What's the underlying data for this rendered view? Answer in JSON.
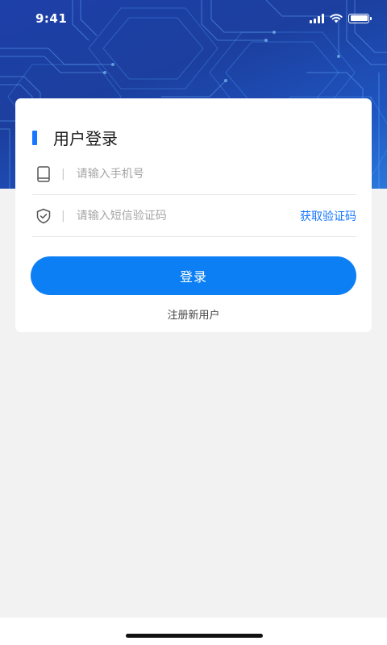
{
  "status_bar": {
    "time": "9:41",
    "icons": [
      "signal-icon",
      "wifi-icon",
      "battery-icon"
    ]
  },
  "login": {
    "title": "用户登录",
    "phone": {
      "placeholder": "请输入手机号",
      "value": "",
      "icon": "phone-icon"
    },
    "code": {
      "placeholder": "请输入短信验证码",
      "value": "",
      "icon": "shield-check-icon"
    },
    "get_code_label": "获取验证码",
    "submit_label": "登录",
    "register_label": "注册新用户"
  },
  "colors": {
    "accent": "#1677ff",
    "button": "#0c7ff5",
    "header_bg": "#1d3fa8",
    "page_bg": "#f2f2f2"
  }
}
